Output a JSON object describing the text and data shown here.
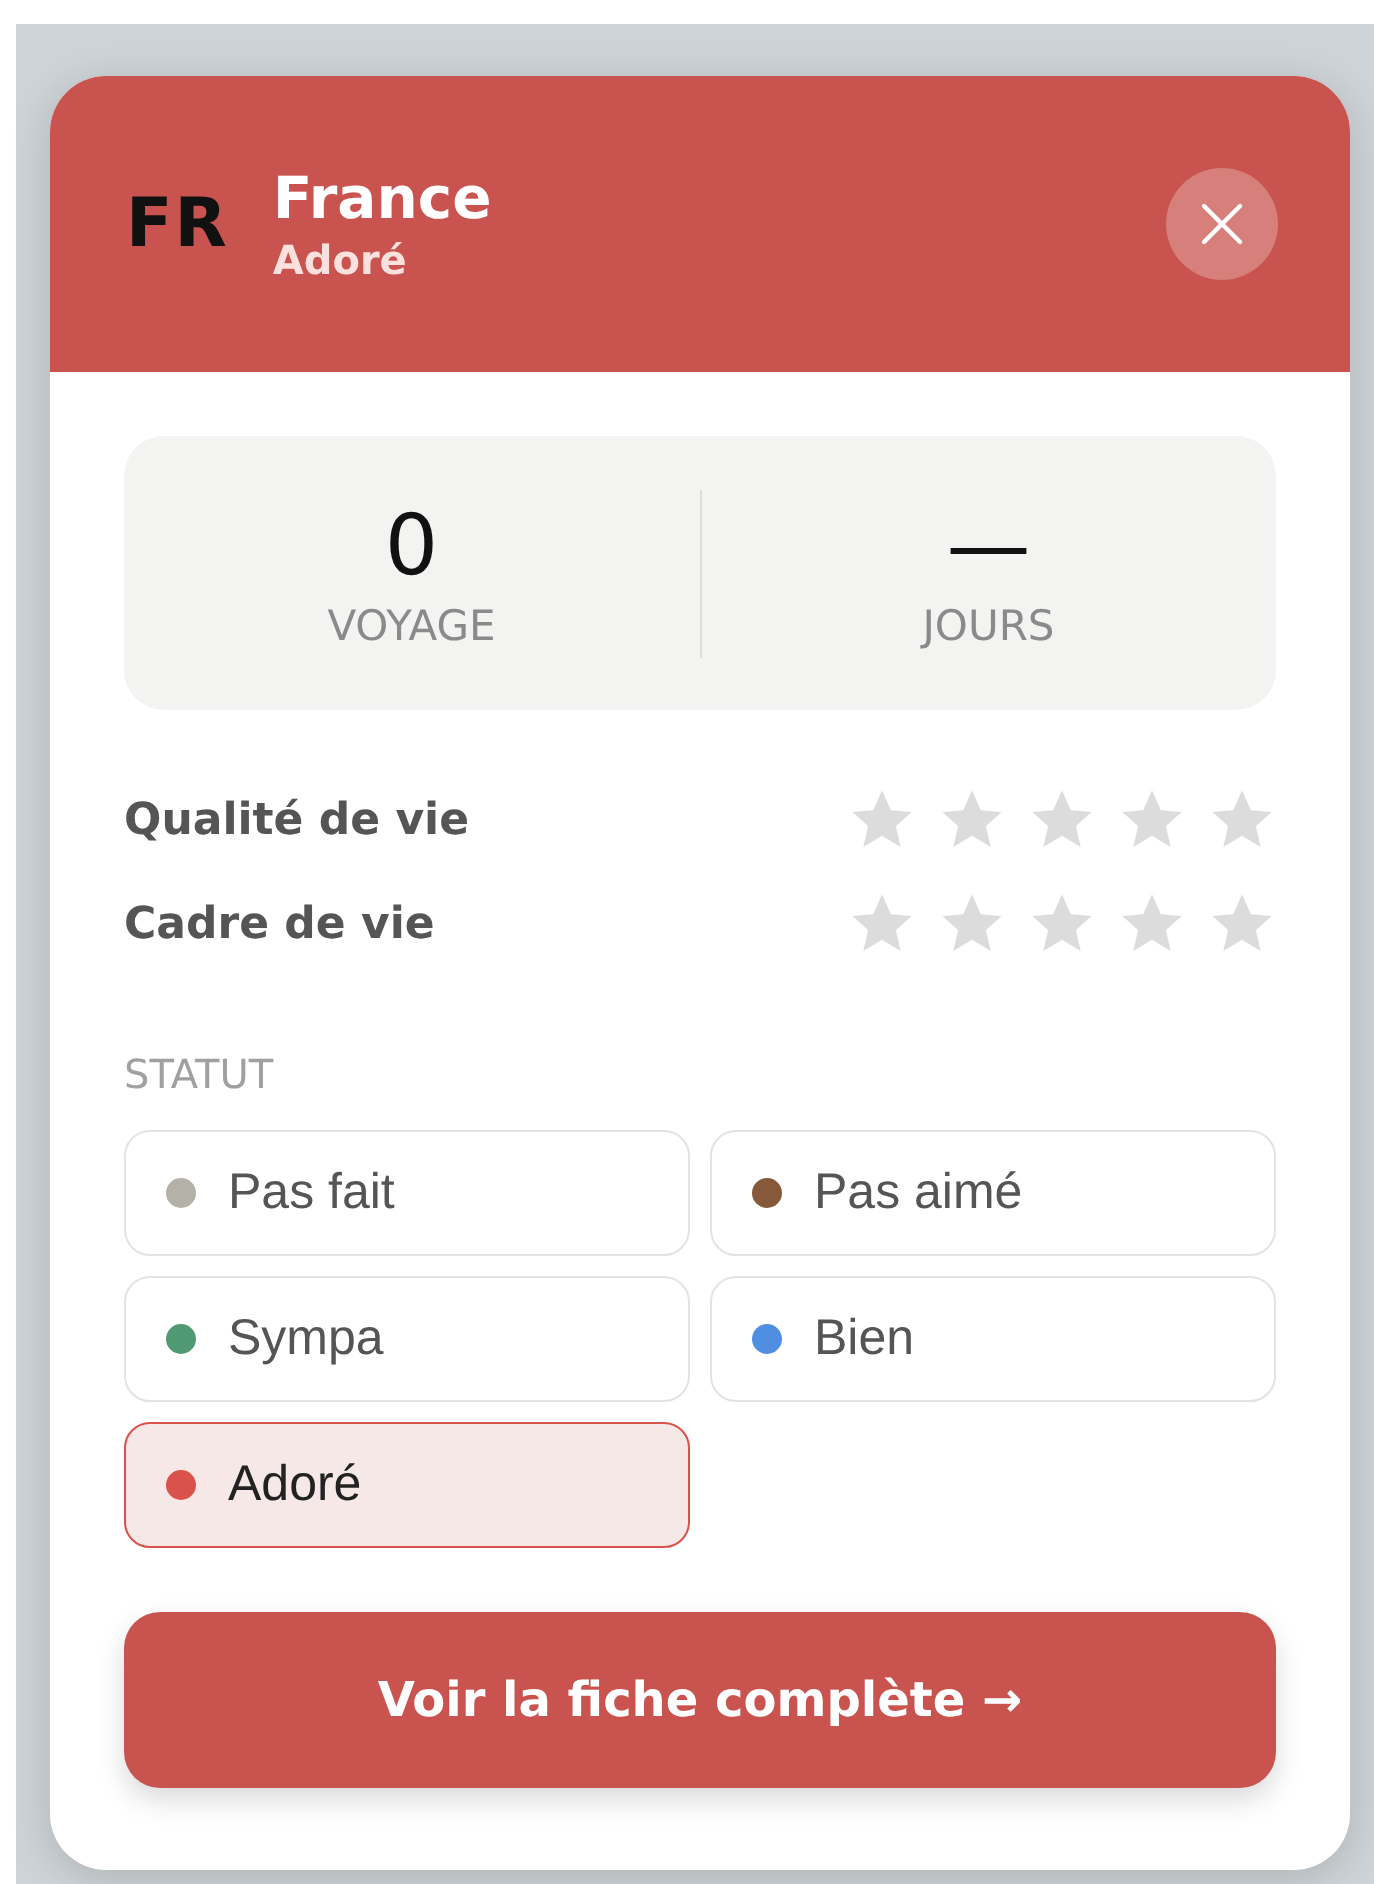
{
  "header": {
    "code": "FR",
    "title": "France",
    "status": "Adoré"
  },
  "stats": [
    {
      "value": "0",
      "label": "VOYAGE"
    },
    {
      "value": "—",
      "label": "JOURS"
    }
  ],
  "ratings": [
    {
      "label": "Qualité de vie",
      "stars": 0
    },
    {
      "label": "Cadre de vie",
      "stars": 0
    }
  ],
  "status_section": {
    "title": "STATUT",
    "options": [
      {
        "label": "Pas fait",
        "color": "#b3b1a8",
        "selected": false
      },
      {
        "label": "Pas aimé",
        "color": "#85593a",
        "selected": false
      },
      {
        "label": "Sympa",
        "color": "#4f9a72",
        "selected": false
      },
      {
        "label": "Bien",
        "color": "#4f8ee0",
        "selected": false
      },
      {
        "label": "Adoré",
        "color": "#d9534c",
        "selected": true
      }
    ]
  },
  "action_button": "Voir la fiche complète →"
}
